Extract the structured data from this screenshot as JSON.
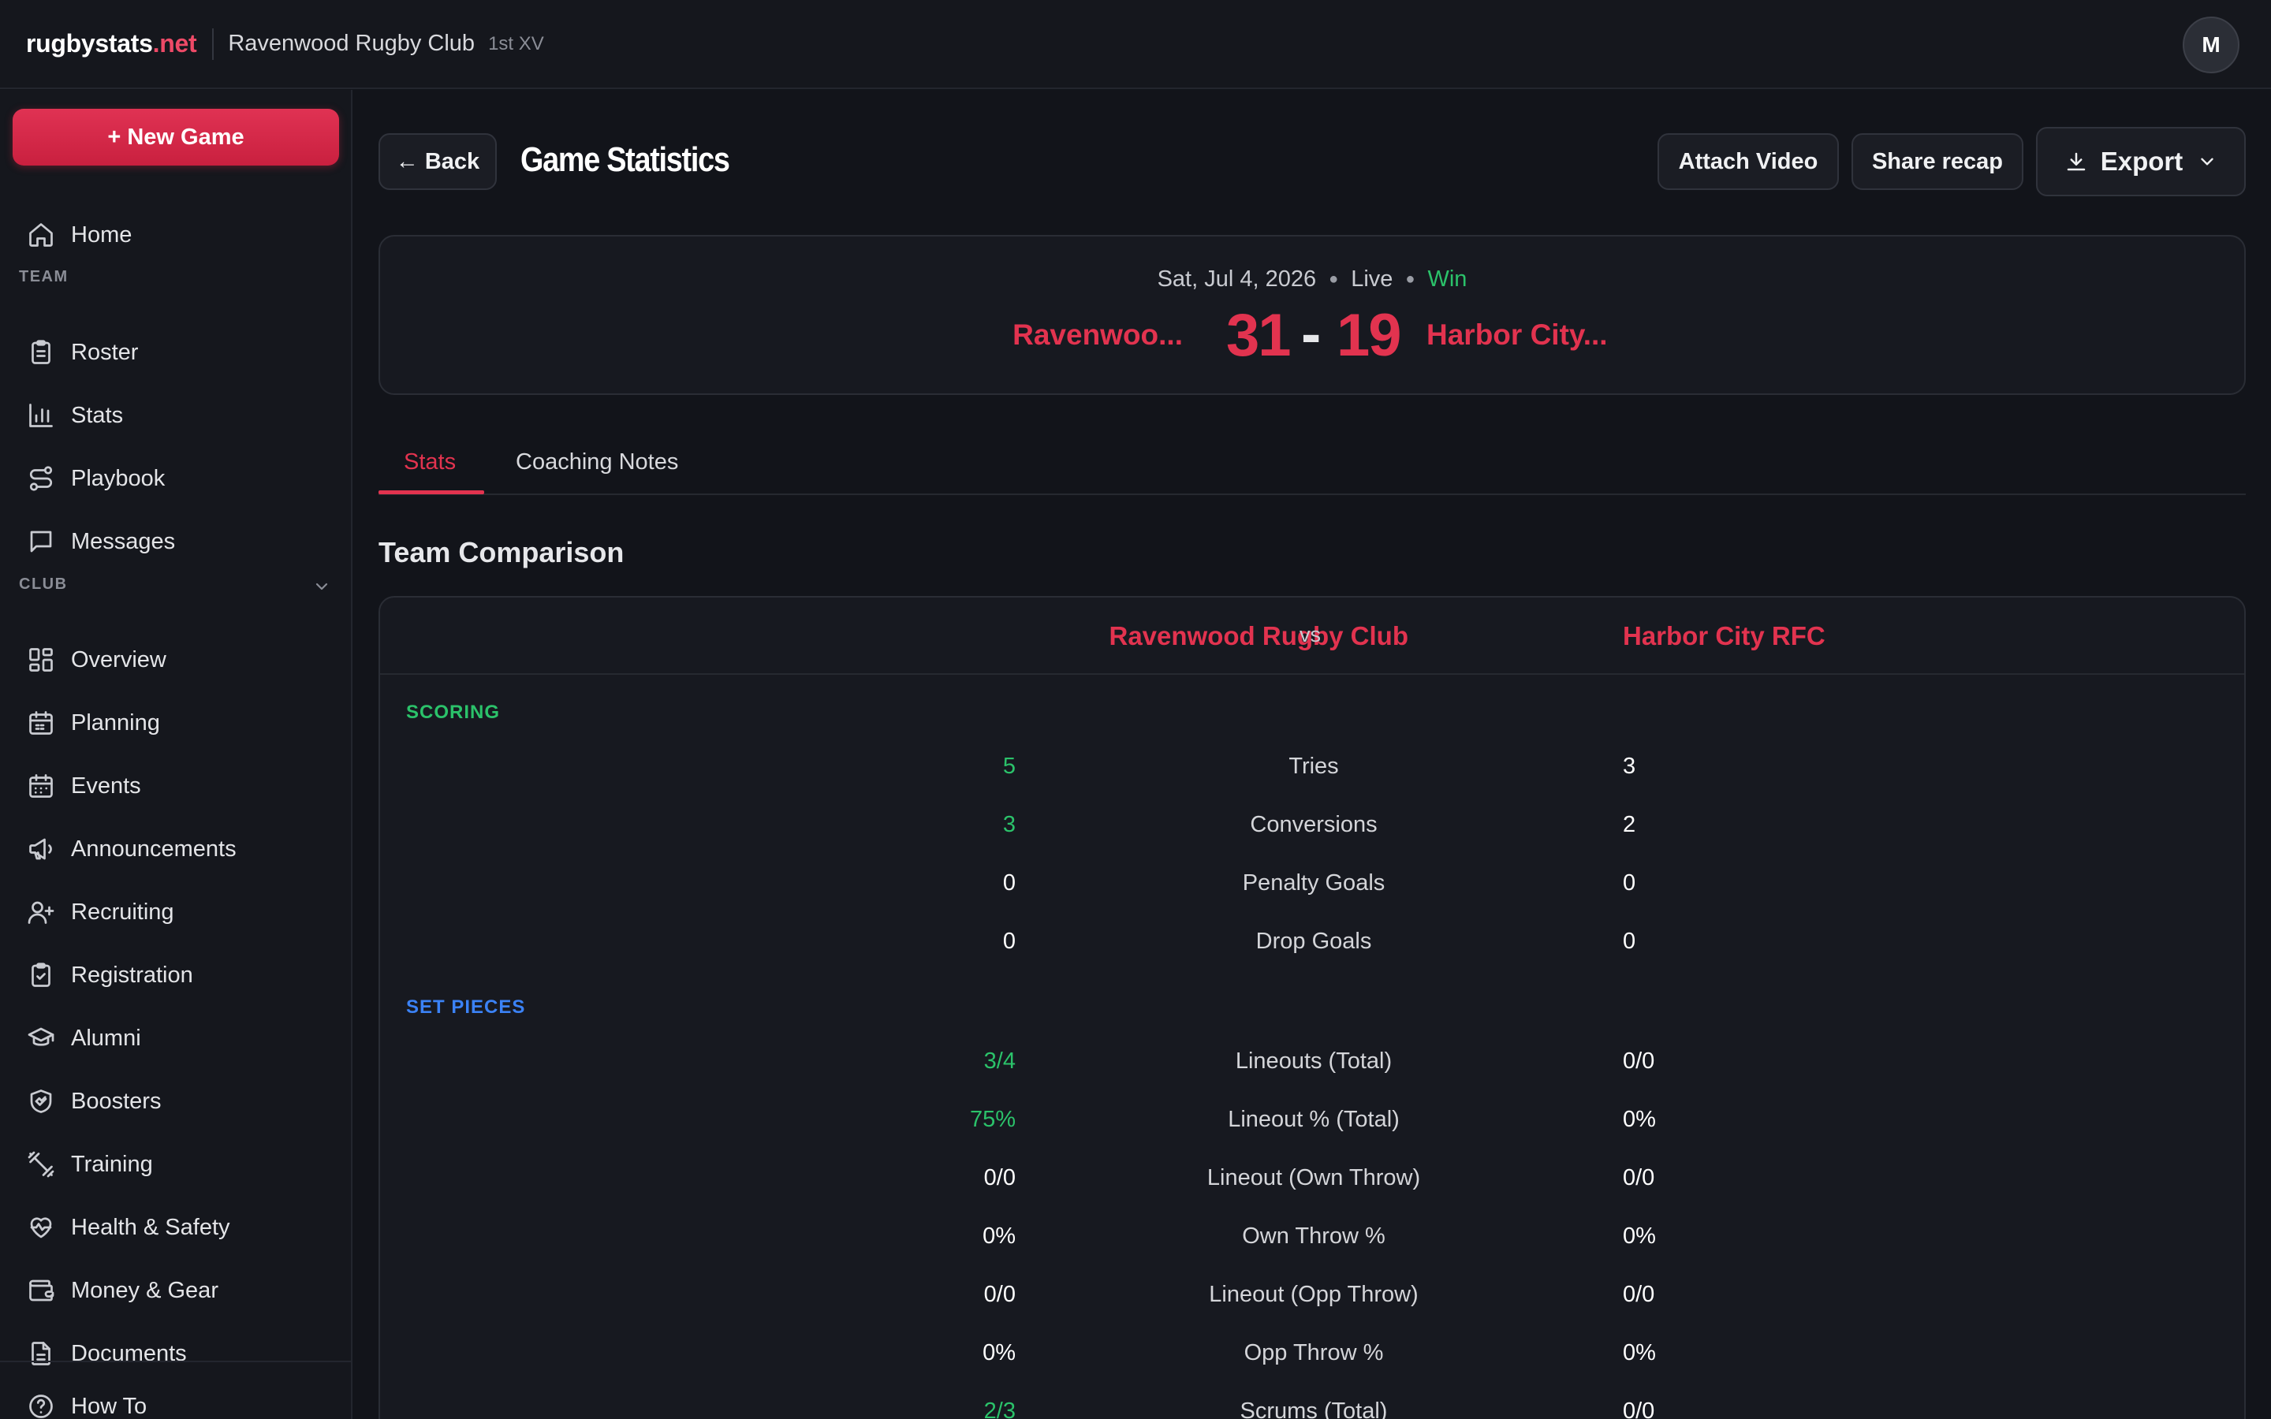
{
  "header": {
    "brand_main": "rugbystats",
    "brand_tld": ".net",
    "club_name": "Ravenwood Rugby Club",
    "squad": "1st XV",
    "avatar_initial": "M"
  },
  "sidebar": {
    "new_game_label": "+ New Game",
    "home_label": "Home",
    "team_section": "TEAM",
    "team_items": [
      {
        "label": "Roster",
        "icon": "clipboard-icon"
      },
      {
        "label": "Stats",
        "icon": "bar-chart-icon"
      },
      {
        "label": "Playbook",
        "icon": "route-icon"
      },
      {
        "label": "Messages",
        "icon": "message-icon"
      }
    ],
    "club_section": "CLUB",
    "club_items": [
      {
        "label": "Overview",
        "icon": "grid-icon"
      },
      {
        "label": "Planning",
        "icon": "calendar-check-icon"
      },
      {
        "label": "Events",
        "icon": "calendar-icon"
      },
      {
        "label": "Announcements",
        "icon": "megaphone-icon"
      },
      {
        "label": "Recruiting",
        "icon": "user-plus-icon"
      },
      {
        "label": "Registration",
        "icon": "clipboard-check-icon"
      },
      {
        "label": "Alumni",
        "icon": "graduation-cap-icon"
      },
      {
        "label": "Boosters",
        "icon": "handshake-icon"
      },
      {
        "label": "Training",
        "icon": "dumbbell-icon"
      },
      {
        "label": "Health & Safety",
        "icon": "heart-pulse-icon"
      },
      {
        "label": "Money & Gear",
        "icon": "wallet-icon"
      },
      {
        "label": "Documents",
        "icon": "document-icon"
      }
    ],
    "how_to_label": "How To"
  },
  "toolbar": {
    "back_label": "← Back",
    "page_title": "Game Statistics",
    "attach_video_label": "Attach Video",
    "share_recap_label": "Share recap",
    "export_label": "Export"
  },
  "game": {
    "date": "Sat, Jul 4, 2026",
    "status": "Live",
    "result": "Win",
    "home_team_short": "Ravenwoo...",
    "away_team_short": "Harbor City...",
    "home_score": "31",
    "score_separator": "-",
    "away_score": "19"
  },
  "tabs": {
    "stats": "Stats",
    "coaching_notes": "Coaching Notes"
  },
  "comparison": {
    "title": "Team Comparison",
    "home_team": "Ravenwood Rugby Club",
    "vs": "vs",
    "away_team": "Harbor City RFC",
    "scoring_label": "SCORING",
    "scoring_rows": [
      {
        "home": "5",
        "metric": "Tries",
        "away": "3",
        "home_leads": true
      },
      {
        "home": "3",
        "metric": "Conversions",
        "away": "2",
        "home_leads": true
      },
      {
        "home": "0",
        "metric": "Penalty Goals",
        "away": "0",
        "home_leads": false
      },
      {
        "home": "0",
        "metric": "Drop Goals",
        "away": "0",
        "home_leads": false
      }
    ],
    "set_pieces_label": "SET PIECES",
    "set_piece_rows": [
      {
        "home": "3/4",
        "metric": "Lineouts (Total)",
        "away": "0/0",
        "home_leads": true
      },
      {
        "home": "75%",
        "metric": "Lineout % (Total)",
        "away": "0%",
        "home_leads": true
      },
      {
        "home": "0/0",
        "metric": "Lineout (Own Throw)",
        "away": "0/0",
        "home_leads": false
      },
      {
        "home": "0%",
        "metric": "Own Throw %",
        "away": "0%",
        "home_leads": false
      },
      {
        "home": "0/0",
        "metric": "Lineout (Opp Throw)",
        "away": "0/0",
        "home_leads": false
      },
      {
        "home": "0%",
        "metric": "Opp Throw %",
        "away": "0%",
        "home_leads": false
      },
      {
        "home": "2/3",
        "metric": "Scrums (Total)",
        "away": "0/0",
        "home_leads": true
      }
    ]
  },
  "colors": {
    "accent": "#e2334f",
    "positive": "#2bc26a",
    "set_pieces": "#3b82f6",
    "background": "#12141a"
  }
}
